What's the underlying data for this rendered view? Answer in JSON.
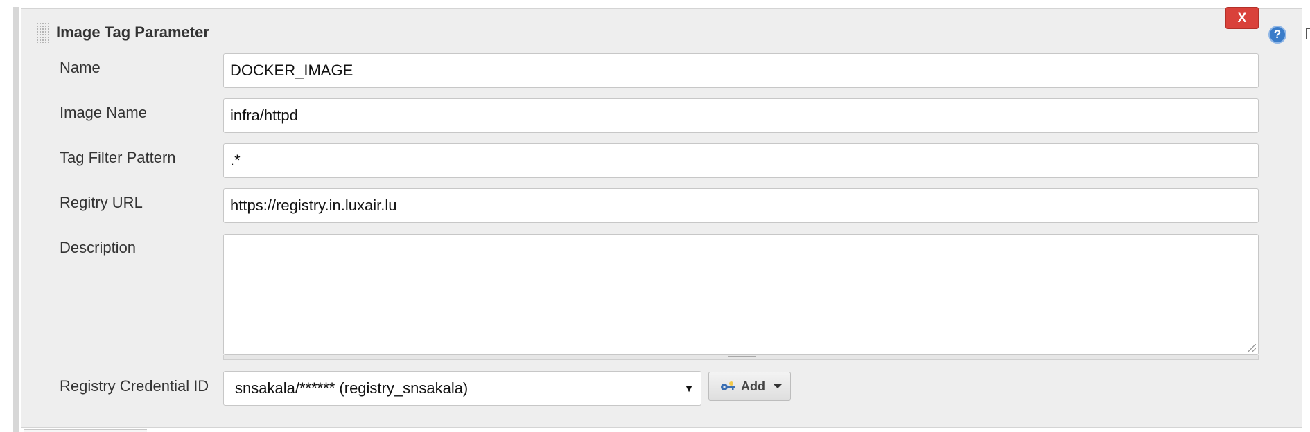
{
  "panel": {
    "title": "Image Tag Parameter",
    "delete_label": "X",
    "help_label": "?"
  },
  "fields": {
    "name": {
      "label": "Name",
      "value": "DOCKER_IMAGE"
    },
    "image_name": {
      "label": "Image Name",
      "value": "infra/httpd"
    },
    "tag_filter": {
      "label": "Tag Filter Pattern",
      "value": ".*"
    },
    "registry_url": {
      "label": "Regitry URL",
      "value": "https://registry.in.luxair.lu"
    },
    "description": {
      "label": "Description",
      "value": ""
    },
    "credential": {
      "label": "Registry Credential ID",
      "selected": "snsakala/****** (registry_snsakala)",
      "arrow": "▼"
    }
  },
  "add_button": {
    "label": "Add",
    "icon": "key-icon"
  },
  "colors": {
    "panel_bg": "#eeeeee",
    "delete_red": "#d9413a",
    "help_blue": "#3a7cc9"
  }
}
